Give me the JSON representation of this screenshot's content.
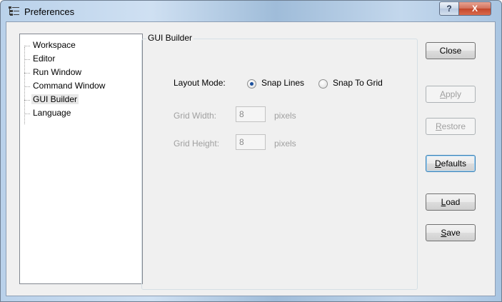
{
  "window": {
    "title": "Preferences",
    "help_glyph": "?",
    "close_glyph": "X"
  },
  "tree": {
    "items": [
      {
        "label": "Workspace",
        "selected": false
      },
      {
        "label": "Editor",
        "selected": false
      },
      {
        "label": "Run Window",
        "selected": false
      },
      {
        "label": "Command Window",
        "selected": false
      },
      {
        "label": "GUI Builder",
        "selected": true
      },
      {
        "label": "Language",
        "selected": false
      }
    ]
  },
  "panel": {
    "group_title": "GUI Builder",
    "layout_mode_label": "Layout Mode:",
    "radio_snap_lines": "Snap Lines",
    "radio_snap_grid": "Snap To Grid",
    "selected_mode": "Snap Lines",
    "grid_width_label": "Grid Width:",
    "grid_width_value": "8",
    "grid_width_unit": "pixels",
    "grid_height_label": "Grid Height:",
    "grid_height_value": "8",
    "grid_height_unit": "pixels"
  },
  "buttons": {
    "close": "Close",
    "apply_first": "A",
    "apply_rest": "pply",
    "restore_first": "R",
    "restore_rest": "estore",
    "defaults_first": "D",
    "defaults_rest": "efaults",
    "load_first": "L",
    "load_rest": "oad",
    "save_first": "S",
    "save_rest": "ave"
  },
  "icons": {
    "title": "preferences-tree-icon",
    "help": "help-icon",
    "close": "close-icon"
  }
}
